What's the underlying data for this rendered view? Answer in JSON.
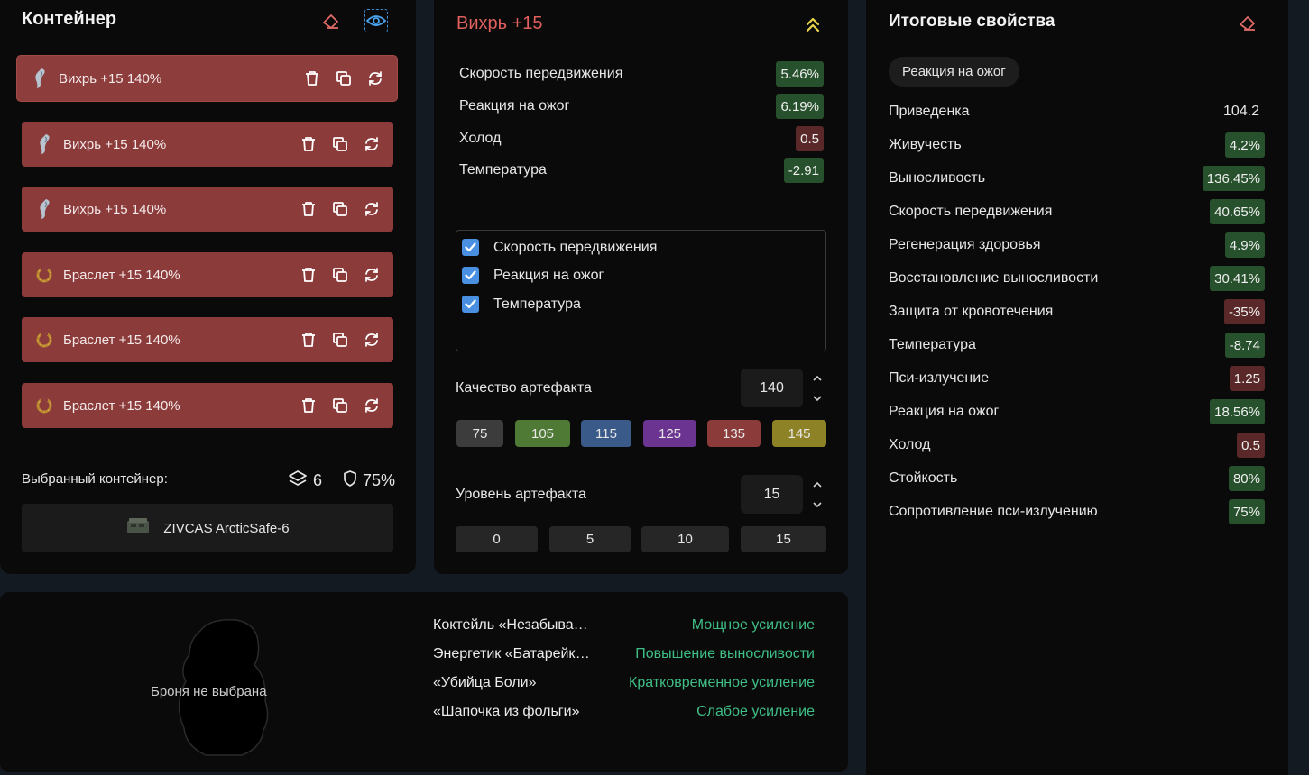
{
  "container_panel": {
    "title": "Контейнер",
    "slots": [
      {
        "name": "Вихрь +15 140%",
        "icon": "whirl-artifact-icon",
        "active": true
      },
      {
        "name": "Вихрь +15 140%",
        "icon": "whirl-artifact-icon",
        "active": false
      },
      {
        "name": "Вихрь +15 140%",
        "icon": "whirl-artifact-icon",
        "active": false
      },
      {
        "name": "Браслет +15 140%",
        "icon": "bracelet-artifact-icon",
        "active": false
      },
      {
        "name": "Браслет +15 140%",
        "icon": "bracelet-artifact-icon",
        "active": false
      },
      {
        "name": "Браслет +15 140%",
        "icon": "bracelet-artifact-icon",
        "active": false
      }
    ],
    "selected_label": "Выбранный контейнер:",
    "slots_count": "6",
    "protection": "75%",
    "container_name": "ZIVCAS ArcticSafe-6"
  },
  "artifact_panel": {
    "title": "Вихрь +15",
    "stats": [
      {
        "label": "Скорость передвижения",
        "value": "5.46%",
        "sign": "pos"
      },
      {
        "label": "Реакция на ожог",
        "value": "6.19%",
        "sign": "pos"
      },
      {
        "label": "Холод",
        "value": "0.5",
        "sign": "neg"
      },
      {
        "label": "Температура",
        "value": "-2.91",
        "sign": "pos"
      }
    ],
    "checkboxes": [
      {
        "label": "Скорость передвижения",
        "checked": true
      },
      {
        "label": "Реакция на ожог",
        "checked": true
      },
      {
        "label": "Температура",
        "checked": true
      }
    ],
    "quality_label": "Качество артефакта",
    "quality_value": "140",
    "quality_options": [
      {
        "label": "75",
        "color": "#3c3c3c"
      },
      {
        "label": "105",
        "color": "#4e7a36"
      },
      {
        "label": "115",
        "color": "#3a5a8a"
      },
      {
        "label": "125",
        "color": "#6a3490"
      },
      {
        "label": "135",
        "color": "#8b3b3a"
      },
      {
        "label": "145",
        "color": "#8e8226"
      }
    ],
    "level_label": "Уровень артефакта",
    "level_value": "15",
    "level_options": [
      "0",
      "5",
      "10",
      "15"
    ]
  },
  "totals_panel": {
    "title": "Итоговые свойства",
    "filter_chip": "Реакция на ожог",
    "rows": [
      {
        "label": "Приведенка",
        "value": "104.2",
        "sign": "plain"
      },
      {
        "label": "Живучесть",
        "value": "4.2%",
        "sign": "pos"
      },
      {
        "label": "Выносливость",
        "value": "136.45%",
        "sign": "pos"
      },
      {
        "label": "Скорость передвижения",
        "value": "40.65%",
        "sign": "pos"
      },
      {
        "label": "Регенерация здоровья",
        "value": "4.9%",
        "sign": "pos"
      },
      {
        "label": "Восстановление выносливости",
        "value": "30.41%",
        "sign": "pos"
      },
      {
        "label": "Защита от кровотечения",
        "value": "-35%",
        "sign": "neg"
      },
      {
        "label": "Температура",
        "value": "-8.74",
        "sign": "pos"
      },
      {
        "label": "Пси-излучение",
        "value": "1.25",
        "sign": "neg"
      },
      {
        "label": "Реакция на ожог",
        "value": "18.56%",
        "sign": "pos"
      },
      {
        "label": "Холод",
        "value": "0.5",
        "sign": "neg"
      },
      {
        "label": "Стойкость",
        "value": "80%",
        "sign": "pos"
      },
      {
        "label": "Сопротивление пси-излучению",
        "value": "75%",
        "sign": "pos"
      }
    ]
  },
  "bottom_panel": {
    "armor_placeholder": "Броня не выбрана",
    "boosts": [
      {
        "name": "Коктейль «Незабываемый»",
        "effect": "Мощное усиление"
      },
      {
        "name": "Энергетик «Батарейка»",
        "effect": "Повышение выносливости"
      },
      {
        "name": "«Убийца Боли»",
        "effect": "Кратковременное усиление"
      },
      {
        "name": "«Шапочка из фольги»",
        "effect": "Слабое усиление"
      }
    ]
  },
  "colors": {
    "accent_red": "#e0605e",
    "accent_yellow": "#e8d24a",
    "accent_blue": "#4a90e2",
    "positive": "#27502c",
    "negative": "#5a2828",
    "boost_green": "#3fbf86"
  }
}
